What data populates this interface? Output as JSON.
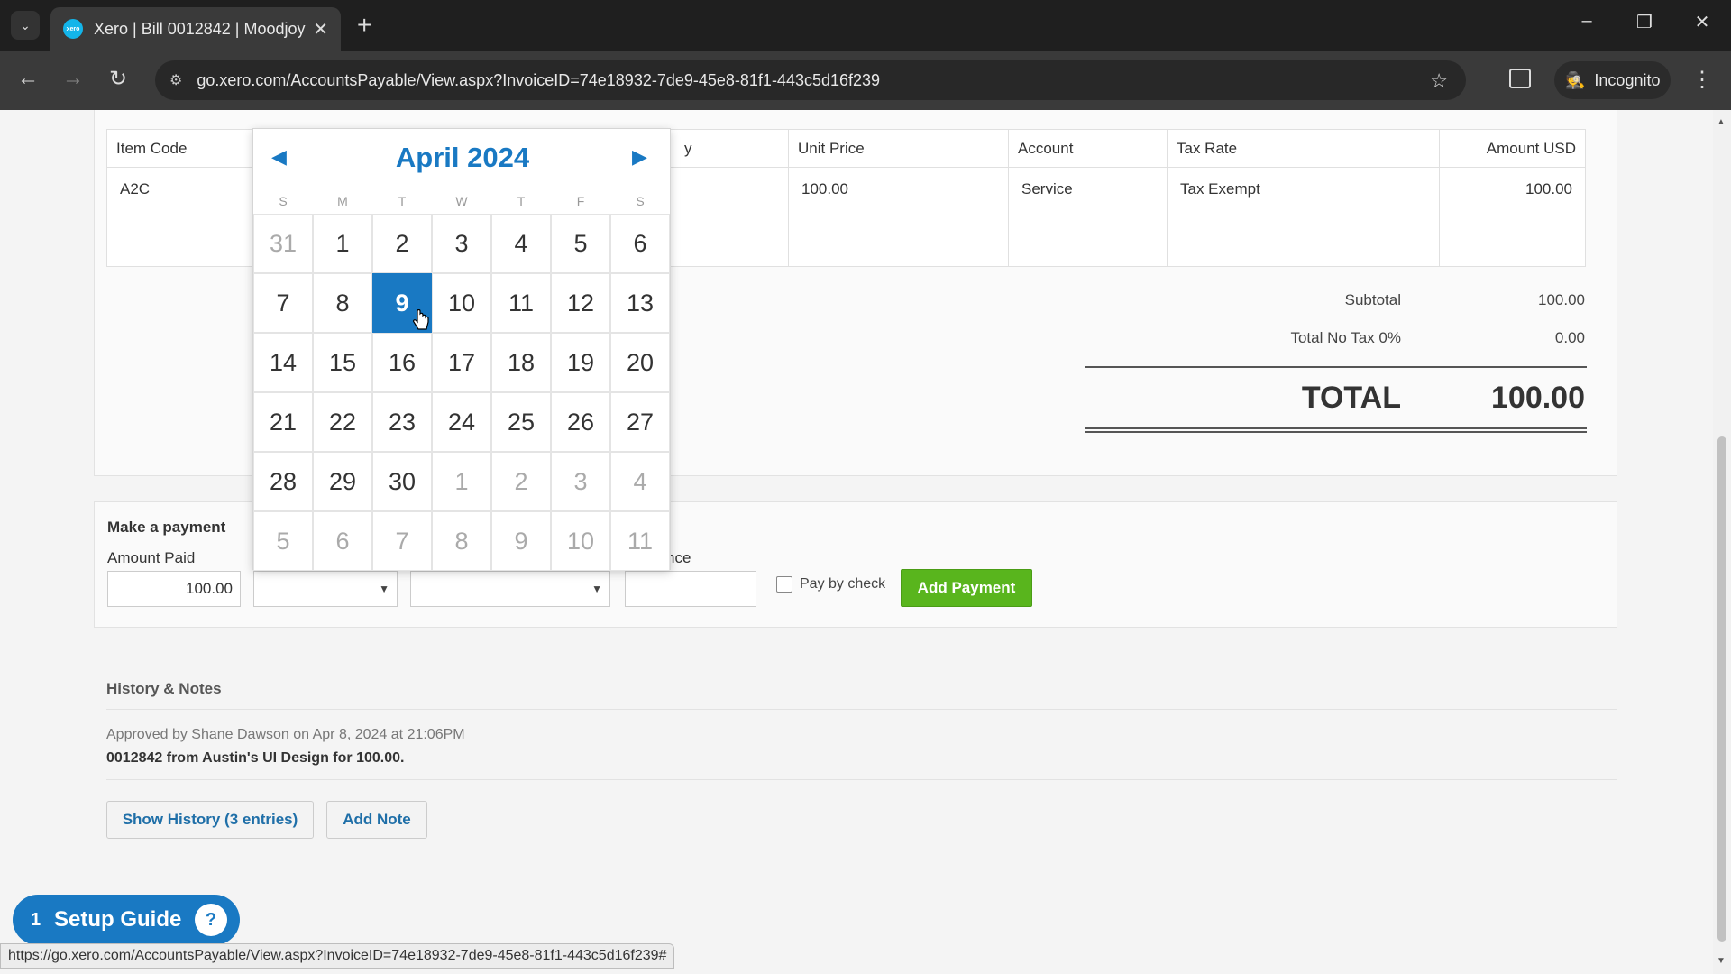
{
  "browser": {
    "tab_title": "Xero | Bill 0012842 | Moodjoy",
    "favicon_text": "xero",
    "url": "go.xero.com/AccountsPayable/View.aspx?InvoiceID=74e18932-7de9-45e8-81f1-443c5d16f239",
    "incognito_label": "Incognito",
    "status_url": "https://go.xero.com/AccountsPayable/View.aspx?InvoiceID=74e18932-7de9-45e8-81f1-443c5d16f239#"
  },
  "items_table": {
    "headers": [
      "Item Code",
      "",
      "Unit Price",
      "Account",
      "Tax Rate",
      "Amount USD"
    ],
    "partial_header": "y",
    "row": {
      "item_code": "A2C",
      "unit_price": "100.00",
      "account": "Service",
      "tax_rate": "Tax Exempt",
      "amount": "100.00"
    }
  },
  "totals": {
    "subtotal_label": "Subtotal",
    "subtotal_value": "100.00",
    "tax_label": "Total No Tax 0%",
    "tax_value": "0.00",
    "total_label": "TOTAL",
    "total_value": "100.00"
  },
  "payment": {
    "title": "Make a payment",
    "amount_label": "Amount Paid",
    "amount_value": "100.00",
    "reference_label_partial": "nce",
    "pay_by_check_label": "Pay by check",
    "add_payment_label": "Add Payment"
  },
  "calendar": {
    "month_title": "April 2024",
    "weekdays": [
      "S",
      "M",
      "T",
      "W",
      "T",
      "F",
      "S"
    ],
    "weeks": [
      [
        "31",
        "1",
        "2",
        "3",
        "4",
        "5",
        "6"
      ],
      [
        "7",
        "8",
        "9",
        "10",
        "11",
        "12",
        "13"
      ],
      [
        "14",
        "15",
        "16",
        "17",
        "18",
        "19",
        "20"
      ],
      [
        "21",
        "22",
        "23",
        "24",
        "25",
        "26",
        "27"
      ],
      [
        "28",
        "29",
        "30",
        "1",
        "2",
        "3",
        "4"
      ],
      [
        "5",
        "6",
        "7",
        "8",
        "9",
        "10",
        "11"
      ]
    ],
    "selected_day": "9"
  },
  "history": {
    "title": "History & Notes",
    "meta": "Approved by Shane Dawson on Apr 8, 2024 at 21:06PM",
    "text": "0012842 from Austin's UI Design for 100.00.",
    "show_history_label": "Show History (3 entries)",
    "add_note_label": "Add Note"
  },
  "setup_guide": {
    "count": "1",
    "label": "Setup Guide"
  },
  "colors": {
    "accent_blue": "#1979c3",
    "add_payment_green": "#59b51d"
  }
}
